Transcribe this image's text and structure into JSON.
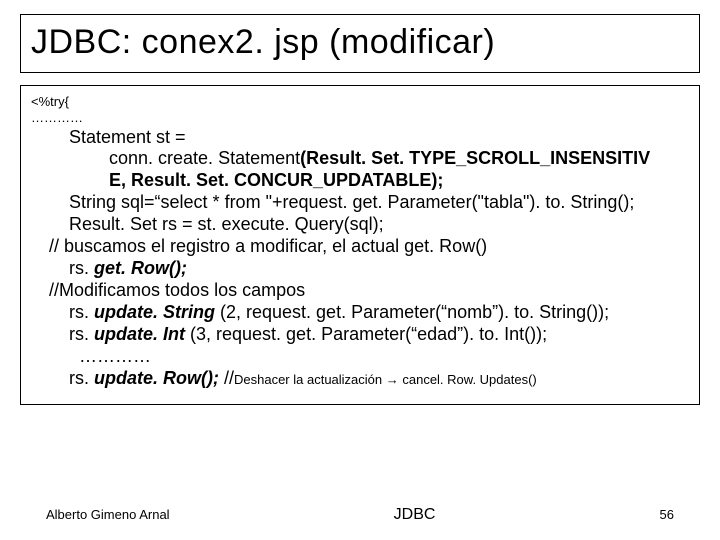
{
  "title": "JDBC: conex2. jsp (modificar)",
  "code": {
    "l1": "<%try{",
    "l2": "…………",
    "l3a": "Statement st =",
    "l3b_pre": "conn. create. Statement",
    "l3b_bold": "(Result. Set. TYPE_SCROLL_INSENSITIV",
    "l3c_bold": "E, Result. Set. CONCUR_UPDATABLE);",
    "l4": "String sql=“select * from \"+request. get. Parameter(\"tabla\"). to. String();",
    "l5": "Result. Set rs = st. execute. Query(sql);",
    "l6": "// buscamos el registro a modificar, el actual get. Row()",
    "l7_pre": "rs. ",
    "l7_ib": "get. Row();",
    "l8": "//Modificamos todos los campos",
    "l9_pre": "rs. ",
    "l9_ib": "update. String ",
    "l9_post": "(2, request. get. Parameter(“nomb”). to. String());",
    "l10_pre": "rs. ",
    "l10_ib": "update. Int ",
    "l10_post": "(3, request. get. Parameter(“edad”). to. Int());",
    "l11": "…………",
    "l12_pre": "rs. ",
    "l12_ib": "update. Row(); ",
    "l12_c_pre": "//",
    "l12_c_small": "Deshacer la actualización → cancel. Row. Updates()"
  },
  "footer": {
    "left": "Alberto Gimeno Arnal",
    "center": "JDBC",
    "right": "56"
  }
}
